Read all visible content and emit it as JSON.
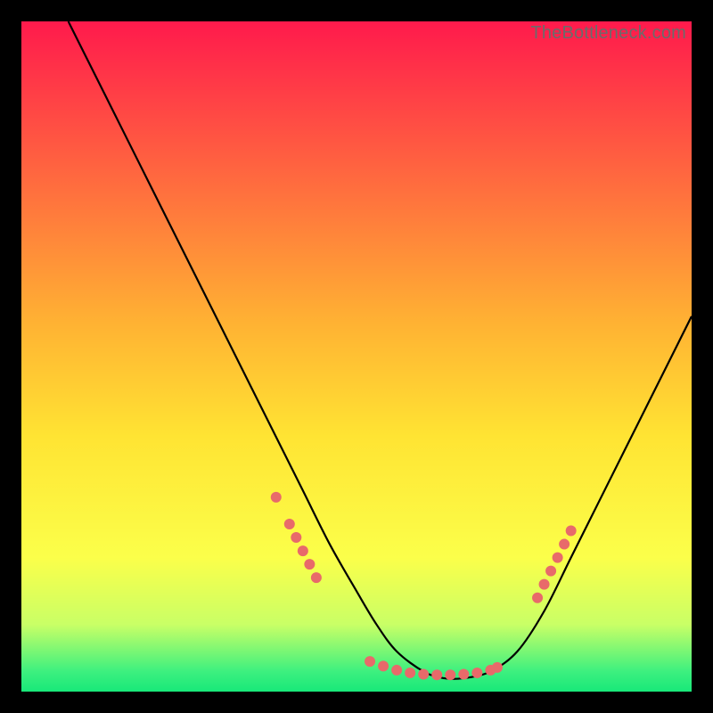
{
  "watermark": "TheBottleneck.com",
  "chart_data": {
    "type": "line",
    "title": "",
    "xlabel": "",
    "ylabel": "",
    "xlim": [
      0,
      100
    ],
    "ylim": [
      0,
      100
    ],
    "grid": false,
    "legend": false,
    "gradient": {
      "stops": [
        {
          "pos": 0.0,
          "color": "#ff1a4c"
        },
        {
          "pos": 0.45,
          "color": "#ffb233"
        },
        {
          "pos": 0.62,
          "color": "#ffe433"
        },
        {
          "pos": 0.8,
          "color": "#fbff4a"
        },
        {
          "pos": 0.9,
          "color": "#c9ff66"
        },
        {
          "pos": 0.97,
          "color": "#3df07f"
        },
        {
          "pos": 1.0,
          "color": "#18e879"
        }
      ]
    },
    "curve": {
      "x": [
        7,
        10,
        14,
        18,
        22,
        26,
        30,
        34,
        38,
        42,
        46,
        50,
        53,
        56,
        60,
        63,
        66,
        70,
        74,
        78,
        82,
        86,
        90,
        94,
        98,
        100
      ],
      "y": [
        100,
        94,
        86,
        78,
        70,
        62,
        54,
        46,
        38,
        30,
        22,
        15,
        10,
        6,
        3,
        2,
        2,
        3,
        6,
        12,
        20,
        28,
        36,
        44,
        52,
        56
      ]
    },
    "markers_left": {
      "x": [
        38,
        40,
        41,
        42,
        43,
        44
      ],
      "y": [
        29,
        25,
        23,
        21,
        19,
        17
      ]
    },
    "markers_bottom": {
      "x": [
        52,
        54,
        56,
        58,
        60,
        62,
        64,
        66,
        68,
        70,
        71
      ],
      "y": [
        4.5,
        3.8,
        3.2,
        2.8,
        2.6,
        2.5,
        2.5,
        2.6,
        2.8,
        3.2,
        3.6
      ]
    },
    "markers_right": {
      "x": [
        77,
        78,
        79,
        80,
        81,
        82
      ],
      "y": [
        14,
        16,
        18,
        20,
        22,
        24
      ]
    },
    "marker_color": "#e86a6a",
    "marker_radius": 6
  }
}
